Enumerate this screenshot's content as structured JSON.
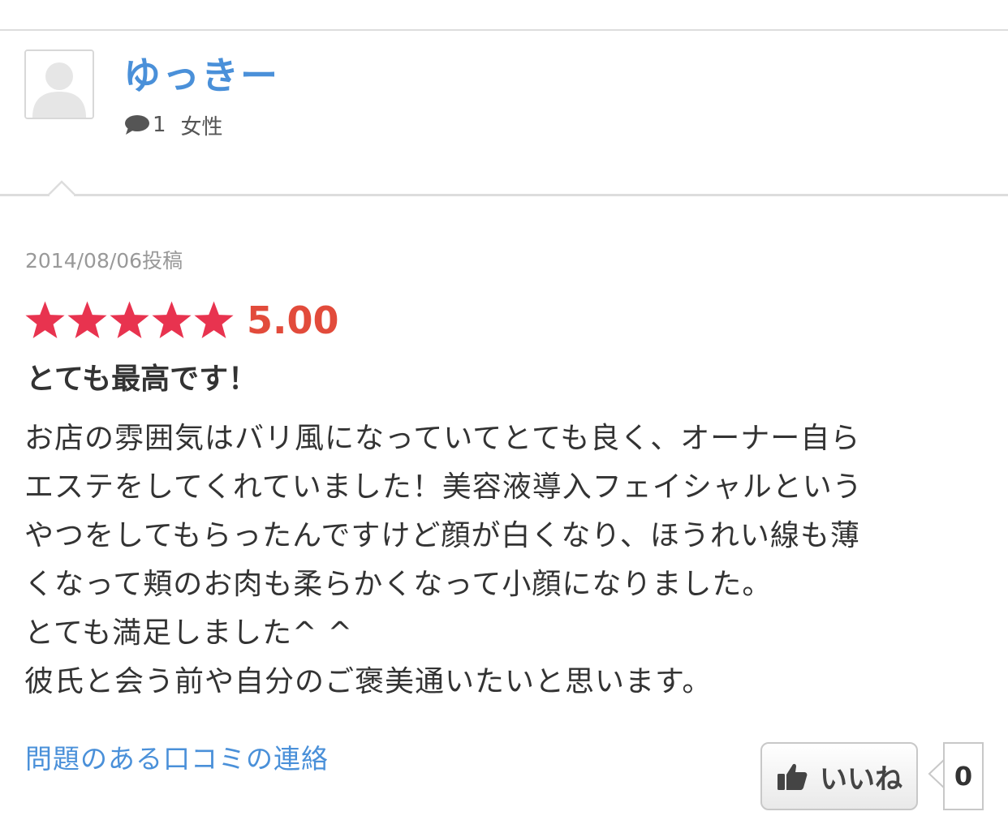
{
  "user": {
    "name": "ゆっきー",
    "comment_count": "1",
    "gender": "女性",
    "avatar_icon": "default-user-avatar-icon"
  },
  "review": {
    "date": "2014/08/06投稿",
    "rating": 5,
    "rating_max": 5,
    "rating_text": "5.00",
    "title": "とても最高です！",
    "body_lines": [
      "お店の雰囲気はバリ風になっていてとても良く、オーナー自ら",
      "エステをしてくれていました！美容液導入フェイシャルという",
      "やつをしてもらったんですけど顔が白くなり、ほうれい線も薄",
      "くなって頬のお肉も柔らかくなって小顔になりました。",
      "とても満足しました^ ^",
      "彼氏と会う前や自分のご褒美通いたいと思います。"
    ]
  },
  "actions": {
    "report_link": "問題のある口コミの連絡",
    "like_label": "いいね",
    "like_count": "0"
  },
  "colors": {
    "username": "#4a90d9",
    "link": "#4a90d9",
    "star": "#e8334f",
    "score": "#e24b3b",
    "divider": "#dddddd"
  }
}
